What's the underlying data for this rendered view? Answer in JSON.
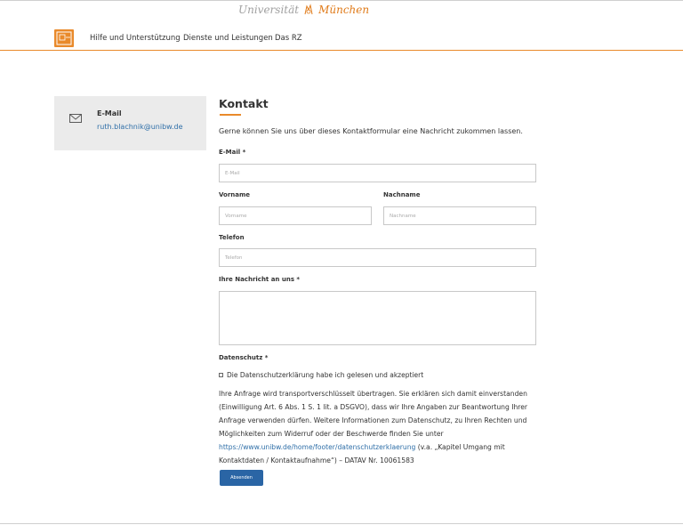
{
  "brand": {
    "left_text": "Universität",
    "right_text": "München",
    "seal_icon": "university-seal-icon"
  },
  "colors": {
    "accent": "#e98a2b",
    "link": "#2f6fa8",
    "button": "#2a65a5",
    "sidebar_bg": "#ebebeb"
  },
  "nav": {
    "logo_icon": "rz-logo-icon",
    "items": [
      "Hilfe und Unterstützung",
      "Dienste und Leistungen",
      "Das RZ"
    ]
  },
  "sidebar": {
    "icon": "mail-icon",
    "label": "E-Mail",
    "email": "ruth.blachnik@unibw.de"
  },
  "main": {
    "title": "Kontakt",
    "intro": "Gerne können Sie uns über dieses Kontaktformular eine Nachricht zukommen lassen."
  },
  "form": {
    "email": {
      "label": "E-Mail *",
      "placeholder": "E-Mail"
    },
    "firstname": {
      "label": "Vorname",
      "placeholder": "Vorname"
    },
    "lastname": {
      "label": "Nachname",
      "placeholder": "Nachname"
    },
    "phone": {
      "label": "Telefon",
      "placeholder": "Telefon"
    },
    "message": {
      "label": "Ihre Nachricht an uns *"
    },
    "privacy": {
      "label": "Datenschutz *",
      "checkbox_label": "Die Datenschutzerklärung habe ich gelesen und akzeptiert"
    },
    "notice": {
      "text_before": "Ihre Anfrage wird transportverschlüsselt übertragen. Sie erklären sich damit einverstanden (Einwilligung Art. 6 Abs. 1 S. 1 lit. a DSGVO), dass wir Ihre Angaben zur Beantwortung Ihrer Anfrage verwenden dürfen. Weitere Informationen zum Datenschutz, zu Ihren Rechten und Möglichkeiten zum Widerruf oder der Beschwerde finden Sie unter",
      "link": "https://www.unibw.de/home/footer/datenschutzerklaerung",
      "text_after": "(v.a. „Kapitel Umgang mit Kontaktdaten / Kontaktaufnahme“) – DATAV Nr. 10061583"
    },
    "submit": "Absenden"
  }
}
